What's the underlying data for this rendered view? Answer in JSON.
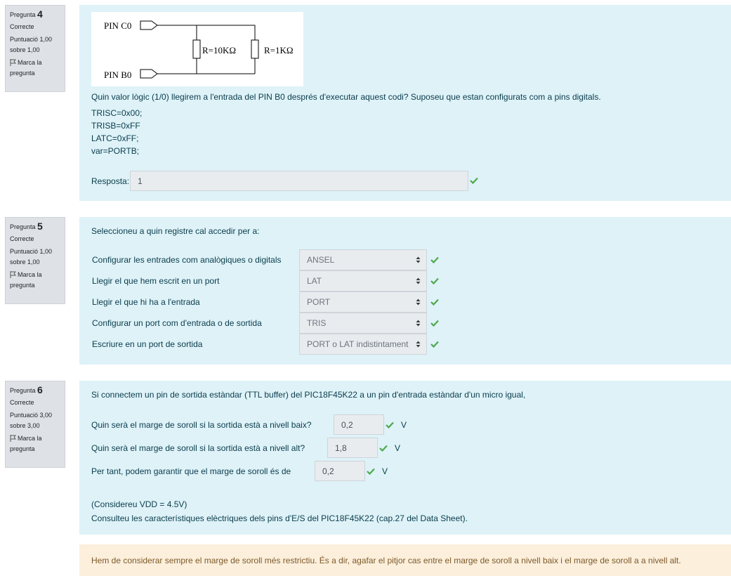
{
  "q4": {
    "info": {
      "pregunta": "Pregunta",
      "number": "4",
      "state": "Correcte",
      "grade_line1": "Puntuació 1,00",
      "grade_line2": "sobre 1,00",
      "flag_line1": "Marca la",
      "flag_line2": "pregunta"
    },
    "circuit": {
      "pin_c0": "PIN C0",
      "pin_b0": "PIN B0",
      "r1": "R=10KΩ",
      "r2": "R=1KΩ"
    },
    "question": "Quin valor lògic (1/0) llegirem a l'entrada del PIN B0 després d'executar aquest codi? Suposeu que estan configurats com a pins digitals.",
    "code": [
      "TRISC=0x00;",
      "TRISB=0xFF",
      "LATC=0xFF;",
      "var=PORTB;"
    ],
    "answer_label": "Resposta:",
    "answer_value": "1"
  },
  "q5": {
    "info": {
      "pregunta": "Pregunta",
      "number": "5",
      "state": "Correcte",
      "grade_line1": "Puntuació 1,00",
      "grade_line2": "sobre 1,00",
      "flag_line1": "Marca la",
      "flag_line2": "pregunta"
    },
    "prompt": "Seleccioneu a quin registre cal accedir per a:",
    "rows": [
      {
        "label": "Configurar les entrades com analògiques o digitals",
        "value": "ANSEL"
      },
      {
        "label": "Llegir el que hem escrit en un port",
        "value": "LAT"
      },
      {
        "label": "Llegir el que hi ha a l'entrada",
        "value": "PORT"
      },
      {
        "label": "Configurar un port com d'entrada o de sortida",
        "value": "TRIS"
      },
      {
        "label": "Escriure en un port de sortida",
        "value": "PORT o LAT indistintament"
      }
    ]
  },
  "q6": {
    "info": {
      "pregunta": "Pregunta",
      "number": "6",
      "state": "Correcte",
      "grade_line1": "Puntuació 3,00",
      "grade_line2": "sobre 3,00",
      "flag_line1": "Marca la",
      "flag_line2": "pregunta"
    },
    "intro": "Si connectem un pin de sortida estàndar (TTL buffer) del PIC18F45K22 a un pin d'entrada estàndar d'un micro igual,",
    "rows": [
      {
        "label": "Quin serà el marge de soroll si la sortida està a nivell baix?",
        "value": "0,2",
        "unit": "V"
      },
      {
        "label": "Quin serà el marge de soroll si la sortida està a nivell alt?",
        "value": "1,8",
        "unit": "V"
      },
      {
        "label": "Per tant, podem garantir que el marge de soroll és de",
        "value": "0,2",
        "unit": "V"
      }
    ],
    "note1": "(Considereu VDD = 4.5V)",
    "note2": "Consulteu les característiques elèctriques dels pins d'E/S del PIC18F45K22 (cap.27 del Data Sheet).",
    "feedback": "Hem de considerar sempre el marge de soroll més restrictiu. És a dir, agafar el pitjor cas entre el marge de soroll a nivell baix i el marge de soroll a a nivell alt."
  },
  "colors": {
    "info_bg": "#dee2e6",
    "formulation_bg": "#def2f8",
    "feedback_bg": "#fcefdc",
    "correct": "#357a32"
  }
}
